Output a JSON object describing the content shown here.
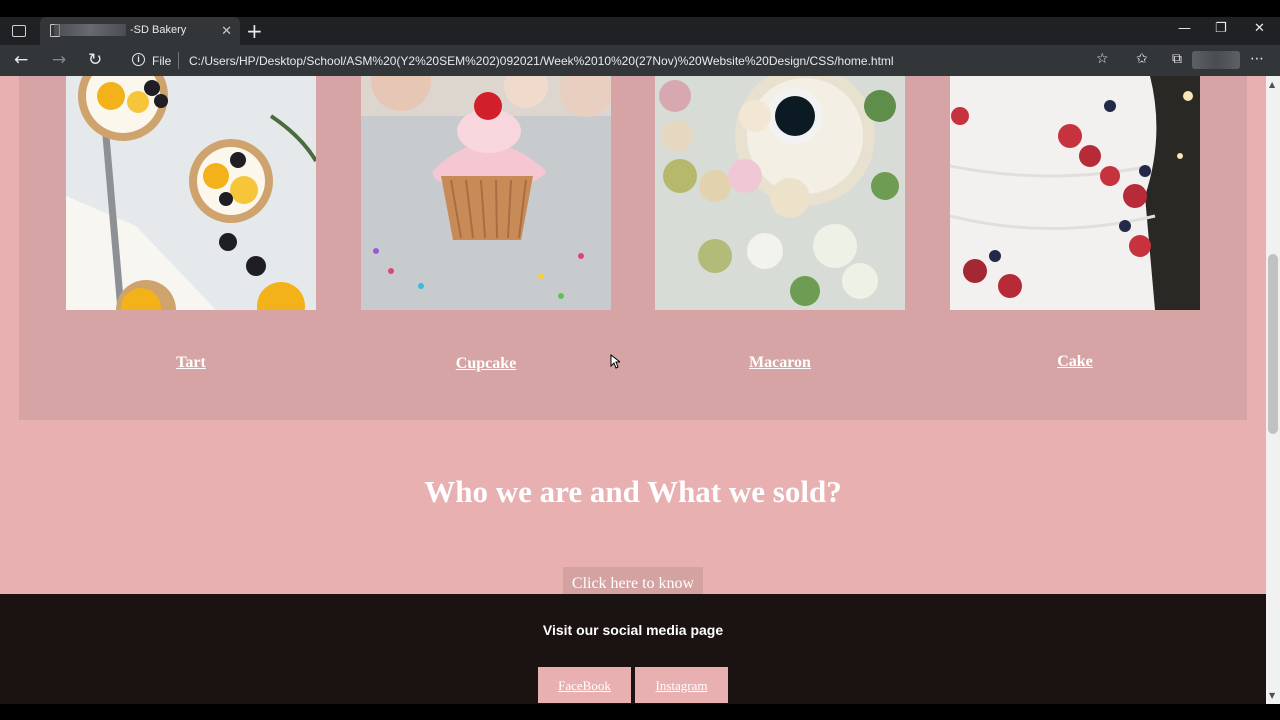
{
  "browser": {
    "tab_title": "-SD Bakery",
    "new_tab_icon": "+",
    "close_tab_icon": "✕",
    "file_label": "File",
    "url": "C:/Users/HP/Desktop/School/ASM%20(Y2%20SEM%202)092021/Week%2010%20(27Nov)%20Website%20Design/CSS/home.html",
    "window_controls": {
      "minimize": "—",
      "maximize": "❐",
      "close": "✕"
    },
    "nav": {
      "back": "←",
      "forward": "→",
      "refresh": "↻"
    },
    "toolbar_icons": {
      "favorite_add": "☆",
      "favorites": "✩",
      "collections": "⧉",
      "more": "⋯"
    }
  },
  "products": [
    {
      "label": "Tart"
    },
    {
      "label": "Cupcake"
    },
    {
      "label": "Macaron"
    },
    {
      "label": "Cake"
    }
  ],
  "about": {
    "heading": "Who we are and What we sold?",
    "button": "Click here to know"
  },
  "footer": {
    "visit_text": "Visit our social media page",
    "links": [
      "FaceBook",
      "Instagram"
    ]
  },
  "colors": {
    "page_bg": "#e8b0b0",
    "panel_bg": "#d6a4a4",
    "footer_bg": "#1b1212"
  }
}
